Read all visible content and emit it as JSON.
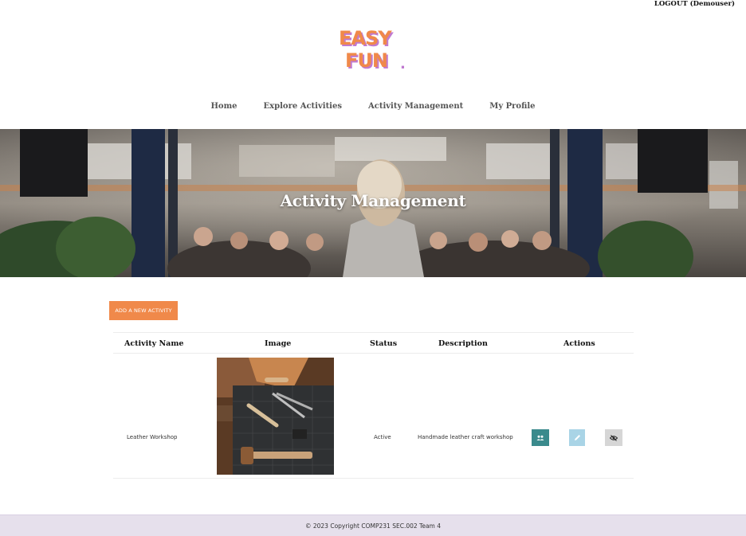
{
  "header": {
    "logout_label": "LOGOUT (Demouser)",
    "logo_text_top": "EASY",
    "logo_text_bottom": "FUN",
    "logo_dot": "."
  },
  "nav": {
    "items": [
      {
        "label": "Home"
      },
      {
        "label": "Explore Activities"
      },
      {
        "label": "Activity Management"
      },
      {
        "label": "My Profile"
      }
    ]
  },
  "hero": {
    "title": "Activity Management"
  },
  "actions_bar": {
    "add_label": "ADD A NEW ACTIVITY"
  },
  "table": {
    "columns": [
      "Activity Name",
      "Image",
      "Status",
      "Description",
      "Actions"
    ],
    "rows": [
      {
        "name": "Leather Workshop",
        "status": "Active",
        "description": "Handmade leather craft workshop",
        "actions": [
          {
            "icon": "users-icon",
            "color": "#3a8a8c"
          },
          {
            "icon": "pencil-icon",
            "color": "#a9d4e6"
          },
          {
            "icon": "eye-slash-icon",
            "color": "#d6d6d6"
          }
        ]
      }
    ]
  },
  "footer": {
    "text": "© 2023 Copyright COMP231 SEC.002 Team 4"
  },
  "colors": {
    "accent": "#f0894a",
    "logo_orange": "#f0894a",
    "logo_purple": "#c07ad0",
    "footer_bg": "#e6e0ec"
  }
}
